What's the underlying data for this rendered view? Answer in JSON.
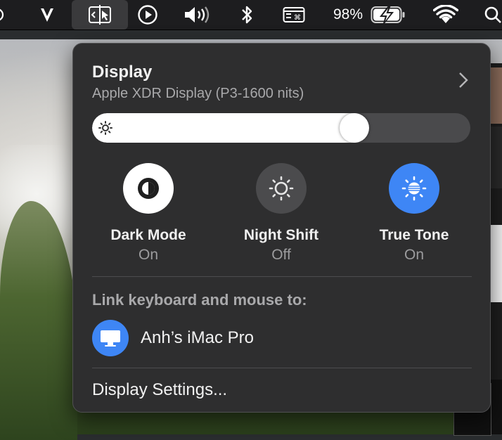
{
  "menubar": {
    "items": [
      {
        "name": "partial-icon-left",
        "icon": "partial-circle-icon"
      },
      {
        "name": "vivaldi-icon",
        "icon": "v-logo-icon"
      },
      {
        "name": "display-mirroring-icon",
        "icon": "display-icon",
        "active": true
      },
      {
        "name": "play-icon",
        "icon": "play-circle-icon"
      },
      {
        "name": "volume-icon",
        "icon": "speaker-icon"
      },
      {
        "name": "bluetooth-icon",
        "icon": "bluetooth-icon"
      },
      {
        "name": "keyboard-input-icon",
        "icon": "input-source-icon"
      },
      {
        "name": "wifi-icon",
        "icon": "wifi-icon"
      },
      {
        "name": "spotlight-icon",
        "icon": "search-icon"
      }
    ],
    "battery_percent": "98%"
  },
  "display_panel": {
    "title": "Display",
    "subtitle": "Apple XDR Display (P3-1600 nits)",
    "brightness_level": 0.71,
    "modes": [
      {
        "label": "Dark Mode",
        "state": "On",
        "icon": "dark-mode-icon"
      },
      {
        "label": "Night Shift",
        "state": "Off",
        "icon": "night-shift-icon"
      },
      {
        "label": "True Tone",
        "state": "On",
        "icon": "true-tone-icon"
      }
    ],
    "link_heading": "Link keyboard and mouse to:",
    "device_name": "Anh’s iMac Pro",
    "settings_link": "Display Settings..."
  },
  "colors": {
    "accent": "#3e86f5",
    "panel_bg": "#2e2e2f",
    "menubar_bg": "#1d1d1f"
  }
}
